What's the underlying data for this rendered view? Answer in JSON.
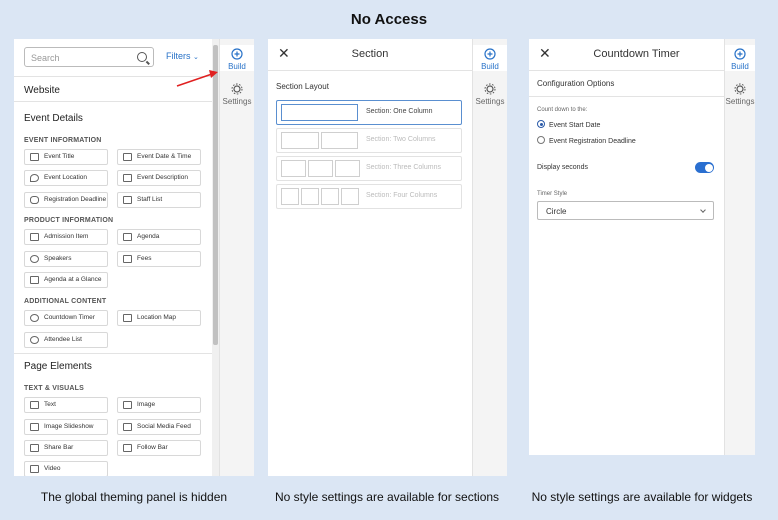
{
  "title": "No Access",
  "captions": [
    "The global theming panel is hidden",
    "No style settings are available for sections",
    "No style settings are available for widgets"
  ],
  "rail": {
    "build": "Build",
    "settings": "Settings"
  },
  "panel1": {
    "search_placeholder": "Search",
    "filters": "Filters",
    "website": "Website",
    "event_details": "Event Details",
    "page_elements": "Page Elements",
    "categories": {
      "event_information": "EVENT INFORMATION",
      "product_information": "PRODUCT INFORMATION",
      "additional_content": "ADDITIONAL CONTENT",
      "text_visuals": "TEXT & VISUALS"
    },
    "widgets": {
      "event_title": "Event Title",
      "event_date_time": "Event Date & Time",
      "event_location": "Event Location",
      "event_description": "Event Description",
      "registration_deadline": "Registration Deadline",
      "staff_list": "Staff List",
      "admission_item": "Admission Item",
      "agenda": "Agenda",
      "speakers": "Speakers",
      "fees": "Fees",
      "agenda_glance": "Agenda at a Glance",
      "countdown_timer": "Countdown Timer",
      "location_map": "Location Map",
      "attendee_list": "Attendee List",
      "text": "Text",
      "image": "Image",
      "image_slideshow": "Image Slideshow",
      "social_media_feed": "Social Media Feed",
      "share_bar": "Share Bar",
      "follow_bar": "Follow Bar",
      "video": "Video"
    }
  },
  "panel2": {
    "title": "Section",
    "section_layout": "Section Layout",
    "options": [
      "Section: One Column",
      "Section: Two Columns",
      "Section: Three Columns",
      "Section: Four Columns"
    ]
  },
  "panel3": {
    "title": "Countdown Timer",
    "config_options": "Configuration Options",
    "count_down_to": "Count down to the:",
    "radio_start": "Event Start Date",
    "radio_deadline": "Event Registration Deadline",
    "display_seconds": "Display seconds",
    "timer_style_label": "Timer Style",
    "timer_style_value": "Circle"
  },
  "colors": {
    "accent": "#2872c8",
    "background": "#dbe6f4",
    "arrow": "#e02020"
  }
}
